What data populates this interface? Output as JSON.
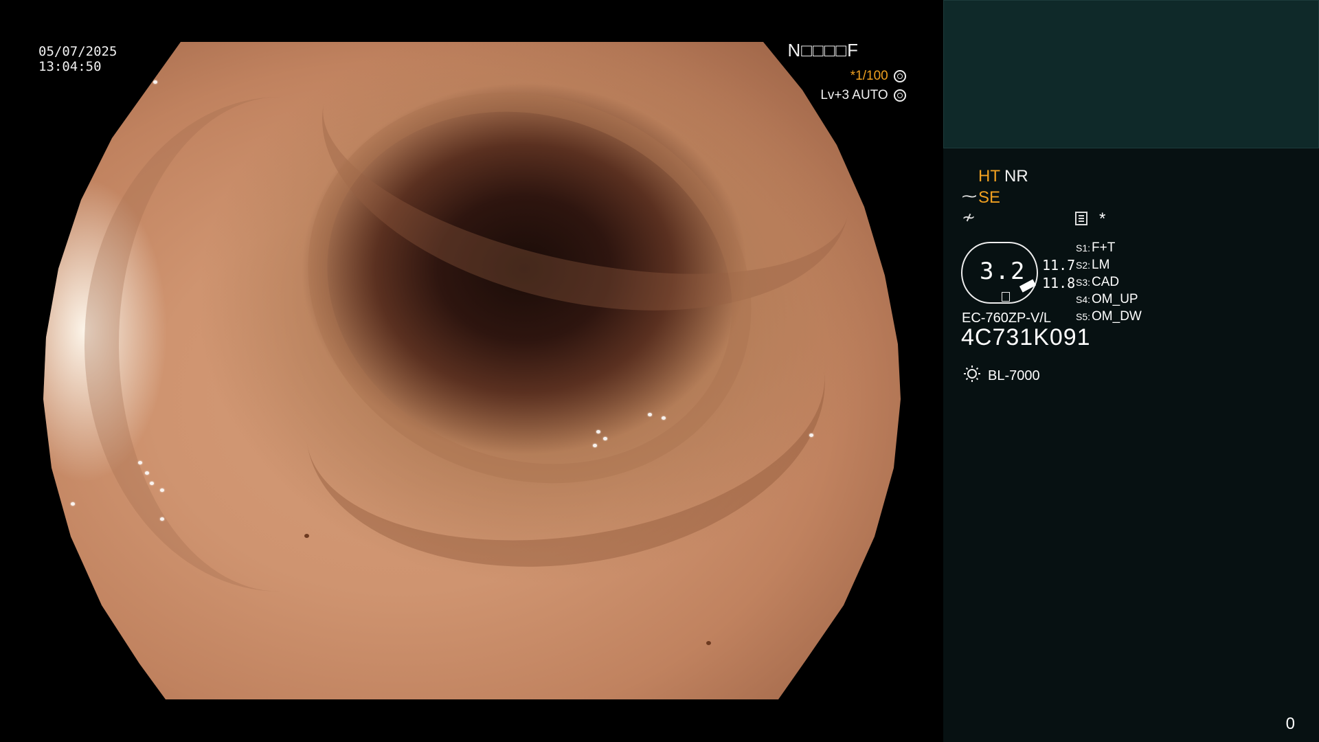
{
  "overlay": {
    "date": "05/07/2025",
    "time": "13:04:50",
    "patient_id": "N□□□□F",
    "shutter": "*1/100",
    "level": "Lv+3 AUTO"
  },
  "panel": {
    "ht": "HT",
    "nr": "NR",
    "se": "SE",
    "asterisk": "*",
    "zoom_value": "3.2",
    "zoom_upper": "11.7",
    "zoom_lower": "11.8",
    "switches": [
      {
        "key": "S1:",
        "value": "F+T"
      },
      {
        "key": "S2:",
        "value": "LM"
      },
      {
        "key": "S3:",
        "value": "CAD"
      },
      {
        "key": "S4:",
        "value": "OM_UP"
      },
      {
        "key": "S5:",
        "value": "OM_DW"
      }
    ],
    "scope_model": "EC-760ZP-V/L",
    "serial": "4C731K091",
    "light_source": "BL-7000",
    "page_counter": "0"
  },
  "icons": [
    "shutter-icon",
    "auto-ring-icon",
    "se-scope-icon",
    "freeze-icon",
    "menu-icon",
    "light-source-icon"
  ],
  "colors": {
    "accent": "#f0a020",
    "panel_bg": "#071112",
    "thumb_bg": "#0f2929"
  }
}
